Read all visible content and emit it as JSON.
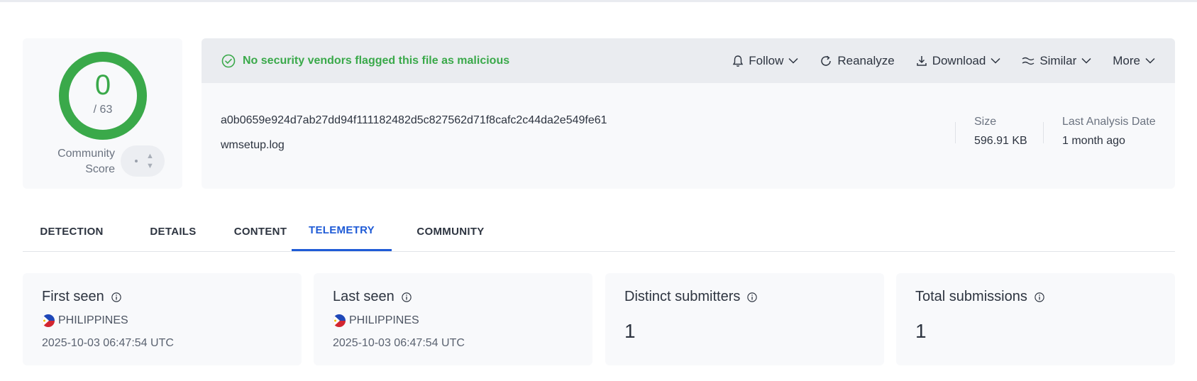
{
  "score": {
    "detections": "0",
    "total": "/ 63",
    "community_label_1": "Community",
    "community_label_2": "Score",
    "ring_color": "#3aa94a"
  },
  "banner": {
    "status_text": "No security vendors flagged this file as malicious"
  },
  "actions": {
    "follow": "Follow",
    "reanalyze": "Reanalyze",
    "download": "Download",
    "similar": "Similar",
    "more": "More"
  },
  "file": {
    "hash": "a0b0659e924d7ab27dd94f111182482d5c827562d71f8cafc2c44da2e549fe61",
    "name": "wmsetup.log",
    "size_label": "Size",
    "size_value": "596.91 KB",
    "date_label": "Last Analysis Date",
    "date_value": "1 month ago"
  },
  "tabs": [
    "DETECTION",
    "DETAILS",
    "CONTENT",
    "TELEMETRY",
    "COMMUNITY"
  ],
  "active_tab": "TELEMETRY",
  "telemetry": {
    "first_seen": {
      "title": "First seen",
      "country": "PHILIPPINES",
      "timestamp": "2025-10-03 06:47:54 UTC"
    },
    "last_seen": {
      "title": "Last seen",
      "country": "PHILIPPINES",
      "timestamp": "2025-10-03 06:47:54 UTC"
    },
    "distinct_submitters": {
      "title": "Distinct submitters",
      "value": "1"
    },
    "total_submissions": {
      "title": "Total submissions",
      "value": "1"
    }
  },
  "colors": {
    "accent": "#1f5bd6",
    "ok": "#3aa94a"
  }
}
